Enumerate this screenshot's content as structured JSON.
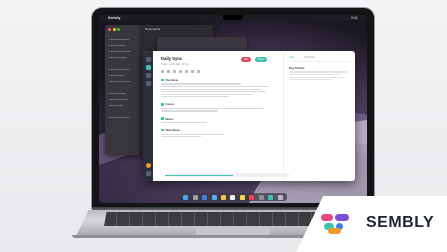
{
  "brand": {
    "name": "SEMBLY",
    "colors": {
      "accent": "#3ec1b3",
      "pink": "#e8497a",
      "orange": "#f39a2b",
      "purple": "#7b4fd6",
      "blue": "#3b7ee8"
    }
  },
  "menubar": {
    "app_name": "Sembly",
    "time": "9:41"
  },
  "finder": {
    "title": "Documents"
  },
  "app": {
    "meeting_title": "Daily Sync",
    "meta": "Today · 10:00 AM · 30 min",
    "record_label": "Rec",
    "share_label": "Share",
    "sections": [
      {
        "title": "Overview"
      },
      {
        "title": "Issues"
      },
      {
        "title": "Notes"
      },
      {
        "title": "Next Steps"
      }
    ],
    "side_tabs": [
      "Chat",
      "Transcript"
    ],
    "side_heading": "Key Points",
    "progress": 0.55
  },
  "dock_icons": [
    "finder-icon",
    "launchpad-icon",
    "safari-icon",
    "mail-icon",
    "photos-icon",
    "calendar-icon",
    "notes-icon",
    "music-icon",
    "settings-icon",
    "sembly-icon",
    "trash-icon"
  ]
}
